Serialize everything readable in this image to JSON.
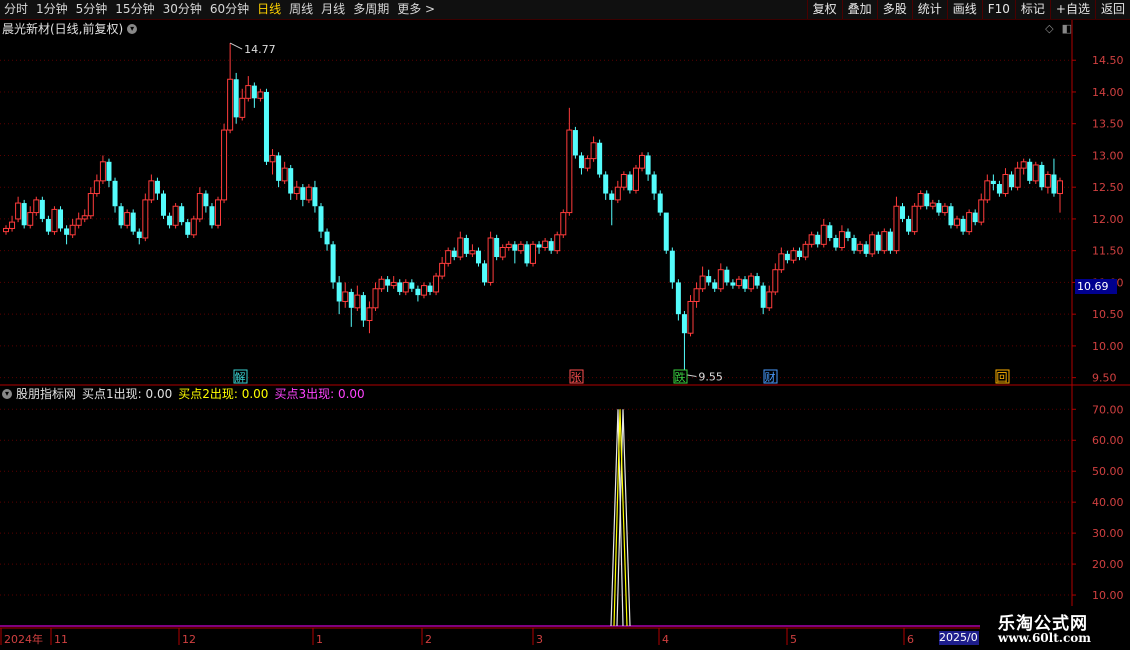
{
  "toolbar": {
    "periods": [
      {
        "label": "分时",
        "active": false
      },
      {
        "label": "1分钟",
        "active": false
      },
      {
        "label": "5分钟",
        "active": false
      },
      {
        "label": "15分钟",
        "active": false
      },
      {
        "label": "30分钟",
        "active": false
      },
      {
        "label": "60分钟",
        "active": false
      },
      {
        "label": "日线",
        "active": true
      },
      {
        "label": "周线",
        "active": false
      },
      {
        "label": "月线",
        "active": false
      },
      {
        "label": "多周期",
        "active": false
      },
      {
        "label": "更多",
        "active": false
      }
    ],
    "right_buttons": [
      "复权",
      "叠加",
      "多股",
      "统计",
      "画线",
      "F10",
      "标记",
      "+自选",
      "返回"
    ]
  },
  "stock_title": "晨光新材(日线,前复权)",
  "price_tag": "10.69",
  "indicator_title": {
    "name": "股朋指标网",
    "item1": "买点1出现: 0.00",
    "item2": "买点2出现: 0.00",
    "item3": "买点3出现: 0.00"
  },
  "colors": {
    "up": "#ff3c3c",
    "down": "#54fcfc",
    "axis": "#b00000",
    "grid": "#5a0000",
    "white_line": "#e8e8e8",
    "yellow_line": "#ffff00",
    "magenta": "#ff00ff"
  },
  "price_axis_labels": [
    "14.50",
    "14.00",
    "13.50",
    "13.00",
    "12.50",
    "12.00",
    "11.50",
    "11.00",
    "10.50",
    "10.00",
    "9.50"
  ],
  "indicator_axis_labels": [
    "70.00",
    "60.00",
    "50.00",
    "40.00",
    "30.00",
    "20.00",
    "10.00"
  ],
  "date_labels": [
    "2024年",
    "11",
    "12",
    "1",
    "2",
    "3",
    "4",
    "5",
    "6",
    "2025/0"
  ],
  "markers": [
    {
      "text": "解",
      "color": "#3ad0d0"
    },
    {
      "text": "张",
      "color": "#ff5050"
    },
    {
      "text": "跌",
      "color": "#3ad040"
    },
    {
      "text": "财",
      "color": "#4a9cff"
    },
    {
      "text": "回",
      "color": "#ffb000"
    }
  ],
  "annotations": {
    "high": "14.77",
    "low": "9.55"
  },
  "logo": {
    "line1": "乐淘公式网",
    "line2": "www.60lt.com"
  },
  "chart_data": {
    "type": "candlestick",
    "price_range": [
      9.4,
      14.85
    ],
    "candles": [
      [
        11.8,
        11.85,
        11.9,
        11.75
      ],
      [
        11.85,
        11.95,
        12.05,
        11.8
      ],
      [
        12.0,
        12.25,
        12.35,
        11.95
      ],
      [
        12.25,
        11.9,
        12.3,
        11.85
      ],
      [
        11.9,
        12.1,
        12.2,
        11.85
      ],
      [
        12.1,
        12.3,
        12.35,
        12.05
      ],
      [
        12.3,
        12.0,
        12.35,
        11.95
      ],
      [
        12.0,
        11.8,
        12.05,
        11.75
      ],
      [
        11.8,
        12.15,
        12.2,
        11.75
      ],
      [
        12.15,
        11.85,
        12.2,
        11.8
      ],
      [
        11.85,
        11.75,
        11.9,
        11.6
      ],
      [
        11.75,
        11.9,
        12.0,
        11.7
      ],
      [
        11.9,
        12.0,
        12.1,
        11.85
      ],
      [
        12.0,
        12.05,
        12.15,
        11.95
      ],
      [
        12.05,
        12.4,
        12.5,
        12.0
      ],
      [
        12.4,
        12.6,
        12.7,
        12.35
      ],
      [
        12.6,
        12.9,
        13.0,
        12.55
      ],
      [
        12.9,
        12.6,
        12.95,
        12.5
      ],
      [
        12.6,
        12.2,
        12.65,
        12.1
      ],
      [
        12.2,
        11.9,
        12.25,
        11.85
      ],
      [
        11.9,
        12.1,
        12.15,
        11.85
      ],
      [
        12.1,
        11.8,
        12.15,
        11.75
      ],
      [
        11.8,
        11.7,
        11.85,
        11.6
      ],
      [
        11.7,
        12.3,
        12.4,
        11.65
      ],
      [
        12.3,
        12.6,
        12.7,
        12.25
      ],
      [
        12.6,
        12.4,
        12.65,
        12.3
      ],
      [
        12.4,
        12.05,
        12.45,
        12.0
      ],
      [
        12.05,
        11.9,
        12.1,
        11.85
      ],
      [
        11.9,
        12.2,
        12.25,
        11.85
      ],
      [
        12.2,
        11.95,
        12.25,
        11.9
      ],
      [
        11.95,
        11.75,
        12.0,
        11.7
      ],
      [
        11.75,
        12.0,
        12.05,
        11.7
      ],
      [
        12.0,
        12.4,
        12.5,
        11.95
      ],
      [
        12.4,
        12.2,
        12.45,
        12.1
      ],
      [
        12.2,
        11.9,
        12.25,
        11.85
      ],
      [
        11.9,
        12.3,
        12.35,
        11.85
      ],
      [
        12.3,
        13.4,
        13.5,
        12.25
      ],
      [
        13.4,
        14.2,
        14.77,
        13.35
      ],
      [
        14.2,
        13.6,
        14.3,
        13.5
      ],
      [
        13.6,
        13.9,
        14.05,
        13.55
      ],
      [
        13.9,
        14.1,
        14.25,
        13.85
      ],
      [
        14.1,
        13.9,
        14.15,
        13.75
      ],
      [
        13.9,
        14.0,
        14.05,
        13.85
      ],
      [
        14.0,
        12.9,
        14.05,
        12.85
      ],
      [
        12.9,
        13.0,
        13.1,
        12.7
      ],
      [
        13.0,
        12.6,
        13.05,
        12.5
      ],
      [
        12.6,
        12.8,
        12.9,
        12.55
      ],
      [
        12.8,
        12.4,
        12.85,
        12.3
      ],
      [
        12.4,
        12.5,
        12.6,
        12.3
      ],
      [
        12.5,
        12.3,
        12.55,
        12.2
      ],
      [
        12.3,
        12.5,
        12.55,
        12.25
      ],
      [
        12.5,
        12.2,
        12.6,
        12.1
      ],
      [
        12.2,
        11.8,
        12.25,
        11.7
      ],
      [
        11.8,
        11.6,
        11.85,
        11.5
      ],
      [
        11.6,
        11.0,
        11.65,
        10.9
      ],
      [
        11.0,
        10.7,
        11.1,
        10.5
      ],
      [
        10.7,
        10.85,
        11.0,
        10.6
      ],
      [
        10.85,
        10.6,
        10.9,
        10.3
      ],
      [
        10.6,
        10.8,
        10.95,
        10.55
      ],
      [
        10.8,
        10.4,
        10.85,
        10.3
      ],
      [
        10.4,
        10.6,
        10.7,
        10.2
      ],
      [
        10.6,
        10.9,
        11.0,
        10.55
      ],
      [
        10.9,
        11.05,
        11.1,
        10.85
      ],
      [
        11.05,
        10.95,
        11.1,
        10.85
      ],
      [
        10.95,
        11.0,
        11.1,
        10.9
      ],
      [
        11.0,
        10.85,
        11.05,
        10.8
      ],
      [
        10.85,
        11.0,
        11.05,
        10.8
      ],
      [
        11.0,
        10.9,
        11.05,
        10.85
      ],
      [
        10.9,
        10.8,
        10.95,
        10.7
      ],
      [
        10.8,
        10.95,
        11.0,
        10.75
      ],
      [
        10.95,
        10.85,
        11.0,
        10.8
      ],
      [
        10.85,
        11.1,
        11.15,
        10.8
      ],
      [
        11.1,
        11.3,
        11.4,
        11.05
      ],
      [
        11.3,
        11.5,
        11.55,
        11.25
      ],
      [
        11.5,
        11.4,
        11.55,
        11.35
      ],
      [
        11.4,
        11.7,
        11.8,
        11.35
      ],
      [
        11.7,
        11.45,
        11.75,
        11.4
      ],
      [
        11.45,
        11.5,
        11.6,
        11.4
      ],
      [
        11.5,
        11.3,
        11.55,
        11.25
      ],
      [
        11.3,
        11.0,
        11.35,
        10.95
      ],
      [
        11.0,
        11.7,
        11.8,
        10.95
      ],
      [
        11.7,
        11.4,
        11.75,
        11.35
      ],
      [
        11.4,
        11.55,
        11.6,
        11.35
      ],
      [
        11.55,
        11.6,
        11.65,
        11.5
      ],
      [
        11.6,
        11.5,
        11.65,
        11.3
      ],
      [
        11.5,
        11.6,
        11.65,
        11.45
      ],
      [
        11.6,
        11.3,
        11.65,
        11.25
      ],
      [
        11.3,
        11.6,
        11.65,
        11.25
      ],
      [
        11.6,
        11.55,
        11.65,
        11.45
      ],
      [
        11.55,
        11.65,
        11.7,
        11.5
      ],
      [
        11.65,
        11.5,
        11.7,
        11.45
      ],
      [
        11.5,
        11.75,
        11.8,
        11.45
      ],
      [
        11.75,
        12.1,
        12.15,
        11.7
      ],
      [
        12.1,
        13.4,
        13.75,
        12.05
      ],
      [
        13.4,
        13.0,
        13.45,
        12.95
      ],
      [
        13.0,
        12.8,
        13.05,
        12.7
      ],
      [
        12.8,
        12.95,
        13.0,
        12.75
      ],
      [
        12.95,
        13.2,
        13.3,
        12.9
      ],
      [
        13.2,
        12.7,
        13.25,
        12.65
      ],
      [
        12.7,
        12.4,
        12.75,
        12.3
      ],
      [
        12.4,
        12.3,
        12.45,
        11.9
      ],
      [
        12.3,
        12.5,
        12.6,
        12.25
      ],
      [
        12.5,
        12.7,
        12.75,
        12.45
      ],
      [
        12.7,
        12.45,
        12.75,
        12.4
      ],
      [
        12.45,
        12.8,
        12.85,
        12.4
      ],
      [
        12.8,
        13.0,
        13.05,
        12.75
      ],
      [
        13.0,
        12.7,
        13.05,
        12.6
      ],
      [
        12.7,
        12.4,
        12.75,
        12.3
      ],
      [
        12.4,
        12.1,
        12.45,
        12.05
      ],
      [
        12.1,
        11.5,
        11.9,
        11.45
      ],
      [
        11.5,
        11.0,
        11.55,
        10.9
      ],
      [
        11.0,
        10.5,
        11.05,
        10.4
      ],
      [
        10.5,
        10.2,
        10.55,
        9.55
      ],
      [
        10.2,
        10.7,
        10.8,
        10.15
      ],
      [
        10.7,
        10.9,
        11.0,
        10.6
      ],
      [
        10.9,
        11.1,
        11.25,
        10.85
      ],
      [
        11.1,
        11.0,
        11.2,
        10.95
      ],
      [
        11.0,
        10.9,
        11.05,
        10.85
      ],
      [
        10.9,
        11.2,
        11.3,
        10.85
      ],
      [
        11.2,
        11.0,
        11.25,
        10.95
      ],
      [
        11.0,
        10.95,
        11.05,
        10.9
      ],
      [
        10.95,
        11.05,
        11.1,
        10.9
      ],
      [
        11.05,
        10.9,
        11.1,
        10.85
      ],
      [
        10.9,
        11.1,
        11.15,
        10.85
      ],
      [
        11.1,
        10.95,
        11.15,
        10.9
      ],
      [
        10.95,
        10.6,
        11.0,
        10.5
      ],
      [
        10.6,
        10.85,
        10.95,
        10.55
      ],
      [
        10.85,
        11.2,
        11.3,
        10.8
      ],
      [
        11.2,
        11.45,
        11.55,
        11.15
      ],
      [
        11.45,
        11.35,
        11.5,
        11.3
      ],
      [
        11.35,
        11.5,
        11.55,
        11.3
      ],
      [
        11.5,
        11.4,
        11.55,
        11.35
      ],
      [
        11.4,
        11.6,
        11.65,
        11.35
      ],
      [
        11.6,
        11.75,
        11.8,
        11.55
      ],
      [
        11.75,
        11.6,
        11.8,
        11.55
      ],
      [
        11.6,
        11.9,
        12.0,
        11.55
      ],
      [
        11.9,
        11.7,
        11.95,
        11.65
      ],
      [
        11.7,
        11.55,
        11.75,
        11.5
      ],
      [
        11.55,
        11.8,
        11.9,
        11.5
      ],
      [
        11.8,
        11.7,
        11.85,
        11.65
      ],
      [
        11.7,
        11.5,
        11.75,
        11.45
      ],
      [
        11.5,
        11.6,
        11.65,
        11.45
      ],
      [
        11.6,
        11.45,
        11.65,
        11.4
      ],
      [
        11.45,
        11.75,
        11.8,
        11.4
      ],
      [
        11.75,
        11.5,
        11.8,
        11.45
      ],
      [
        11.5,
        11.8,
        11.85,
        11.45
      ],
      [
        11.8,
        11.5,
        11.85,
        11.45
      ],
      [
        11.5,
        12.2,
        12.35,
        11.45
      ],
      [
        12.2,
        12.0,
        12.25,
        11.95
      ],
      [
        12.0,
        11.8,
        12.05,
        11.75
      ],
      [
        11.8,
        12.2,
        12.25,
        11.75
      ],
      [
        12.2,
        12.4,
        12.45,
        12.15
      ],
      [
        12.4,
        12.2,
        12.45,
        12.15
      ],
      [
        12.2,
        12.25,
        12.3,
        12.15
      ],
      [
        12.25,
        12.1,
        12.3,
        12.05
      ],
      [
        12.1,
        12.2,
        12.25,
        12.05
      ],
      [
        12.2,
        11.9,
        12.25,
        11.85
      ],
      [
        11.9,
        12.0,
        12.05,
        11.85
      ],
      [
        12.0,
        11.8,
        12.05,
        11.75
      ],
      [
        11.8,
        12.1,
        12.15,
        11.75
      ],
      [
        12.1,
        11.95,
        12.15,
        11.9
      ],
      [
        11.95,
        12.3,
        12.4,
        11.9
      ],
      [
        12.3,
        12.6,
        12.7,
        12.25
      ],
      [
        12.6,
        12.55,
        12.7,
        12.45
      ],
      [
        12.55,
        12.4,
        12.6,
        12.35
      ],
      [
        12.4,
        12.7,
        12.8,
        12.35
      ],
      [
        12.7,
        12.5,
        12.75,
        12.45
      ],
      [
        12.5,
        12.8,
        12.9,
        12.45
      ],
      [
        12.8,
        12.9,
        12.95,
        12.7
      ],
      [
        12.9,
        12.6,
        12.95,
        12.55
      ],
      [
        12.6,
        12.85,
        12.9,
        12.55
      ],
      [
        12.85,
        12.5,
        12.9,
        12.45
      ],
      [
        12.5,
        12.7,
        12.75,
        12.4
      ],
      [
        12.7,
        12.4,
        12.95,
        12.35
      ],
      [
        12.4,
        12.6,
        12.65,
        12.1
      ]
    ],
    "indicator": {
      "range": [
        0,
        73
      ],
      "spike_value": 70,
      "series": [
        "white",
        "yellow"
      ]
    }
  }
}
